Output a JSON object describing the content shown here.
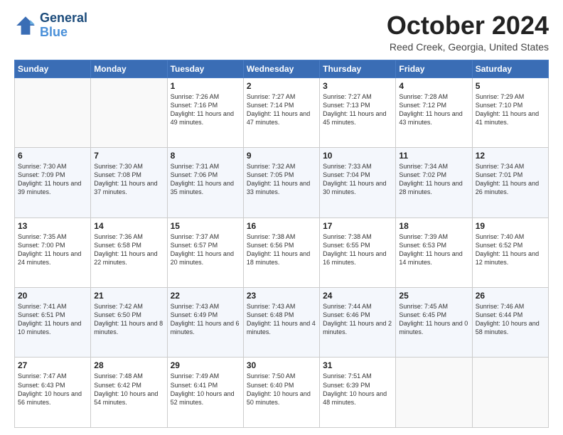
{
  "header": {
    "logo_general": "General",
    "logo_blue": "Blue",
    "title": "October 2024",
    "subtitle": "Reed Creek, Georgia, United States"
  },
  "days_of_week": [
    "Sunday",
    "Monday",
    "Tuesday",
    "Wednesday",
    "Thursday",
    "Friday",
    "Saturday"
  ],
  "weeks": [
    [
      {
        "day": "",
        "empty": true
      },
      {
        "day": "",
        "empty": true
      },
      {
        "day": "1",
        "sunrise": "7:26 AM",
        "sunset": "7:16 PM",
        "daylight": "11 hours and 49 minutes."
      },
      {
        "day": "2",
        "sunrise": "7:27 AM",
        "sunset": "7:14 PM",
        "daylight": "11 hours and 47 minutes."
      },
      {
        "day": "3",
        "sunrise": "7:27 AM",
        "sunset": "7:13 PM",
        "daylight": "11 hours and 45 minutes."
      },
      {
        "day": "4",
        "sunrise": "7:28 AM",
        "sunset": "7:12 PM",
        "daylight": "11 hours and 43 minutes."
      },
      {
        "day": "5",
        "sunrise": "7:29 AM",
        "sunset": "7:10 PM",
        "daylight": "11 hours and 41 minutes."
      }
    ],
    [
      {
        "day": "6",
        "sunrise": "7:30 AM",
        "sunset": "7:09 PM",
        "daylight": "11 hours and 39 minutes."
      },
      {
        "day": "7",
        "sunrise": "7:30 AM",
        "sunset": "7:08 PM",
        "daylight": "11 hours and 37 minutes."
      },
      {
        "day": "8",
        "sunrise": "7:31 AM",
        "sunset": "7:06 PM",
        "daylight": "11 hours and 35 minutes."
      },
      {
        "day": "9",
        "sunrise": "7:32 AM",
        "sunset": "7:05 PM",
        "daylight": "11 hours and 33 minutes."
      },
      {
        "day": "10",
        "sunrise": "7:33 AM",
        "sunset": "7:04 PM",
        "daylight": "11 hours and 30 minutes."
      },
      {
        "day": "11",
        "sunrise": "7:34 AM",
        "sunset": "7:02 PM",
        "daylight": "11 hours and 28 minutes."
      },
      {
        "day": "12",
        "sunrise": "7:34 AM",
        "sunset": "7:01 PM",
        "daylight": "11 hours and 26 minutes."
      }
    ],
    [
      {
        "day": "13",
        "sunrise": "7:35 AM",
        "sunset": "7:00 PM",
        "daylight": "11 hours and 24 minutes."
      },
      {
        "day": "14",
        "sunrise": "7:36 AM",
        "sunset": "6:58 PM",
        "daylight": "11 hours and 22 minutes."
      },
      {
        "day": "15",
        "sunrise": "7:37 AM",
        "sunset": "6:57 PM",
        "daylight": "11 hours and 20 minutes."
      },
      {
        "day": "16",
        "sunrise": "7:38 AM",
        "sunset": "6:56 PM",
        "daylight": "11 hours and 18 minutes."
      },
      {
        "day": "17",
        "sunrise": "7:38 AM",
        "sunset": "6:55 PM",
        "daylight": "11 hours and 16 minutes."
      },
      {
        "day": "18",
        "sunrise": "7:39 AM",
        "sunset": "6:53 PM",
        "daylight": "11 hours and 14 minutes."
      },
      {
        "day": "19",
        "sunrise": "7:40 AM",
        "sunset": "6:52 PM",
        "daylight": "11 hours and 12 minutes."
      }
    ],
    [
      {
        "day": "20",
        "sunrise": "7:41 AM",
        "sunset": "6:51 PM",
        "daylight": "11 hours and 10 minutes."
      },
      {
        "day": "21",
        "sunrise": "7:42 AM",
        "sunset": "6:50 PM",
        "daylight": "11 hours and 8 minutes."
      },
      {
        "day": "22",
        "sunrise": "7:43 AM",
        "sunset": "6:49 PM",
        "daylight": "11 hours and 6 minutes."
      },
      {
        "day": "23",
        "sunrise": "7:43 AM",
        "sunset": "6:48 PM",
        "daylight": "11 hours and 4 minutes."
      },
      {
        "day": "24",
        "sunrise": "7:44 AM",
        "sunset": "6:46 PM",
        "daylight": "11 hours and 2 minutes."
      },
      {
        "day": "25",
        "sunrise": "7:45 AM",
        "sunset": "6:45 PM",
        "daylight": "11 hours and 0 minutes."
      },
      {
        "day": "26",
        "sunrise": "7:46 AM",
        "sunset": "6:44 PM",
        "daylight": "10 hours and 58 minutes."
      }
    ],
    [
      {
        "day": "27",
        "sunrise": "7:47 AM",
        "sunset": "6:43 PM",
        "daylight": "10 hours and 56 minutes."
      },
      {
        "day": "28",
        "sunrise": "7:48 AM",
        "sunset": "6:42 PM",
        "daylight": "10 hours and 54 minutes."
      },
      {
        "day": "29",
        "sunrise": "7:49 AM",
        "sunset": "6:41 PM",
        "daylight": "10 hours and 52 minutes."
      },
      {
        "day": "30",
        "sunrise": "7:50 AM",
        "sunset": "6:40 PM",
        "daylight": "10 hours and 50 minutes."
      },
      {
        "day": "31",
        "sunrise": "7:51 AM",
        "sunset": "6:39 PM",
        "daylight": "10 hours and 48 minutes."
      },
      {
        "day": "",
        "empty": true
      },
      {
        "day": "",
        "empty": true
      }
    ]
  ],
  "labels": {
    "sunrise": "Sunrise:",
    "sunset": "Sunset:",
    "daylight": "Daylight:"
  }
}
